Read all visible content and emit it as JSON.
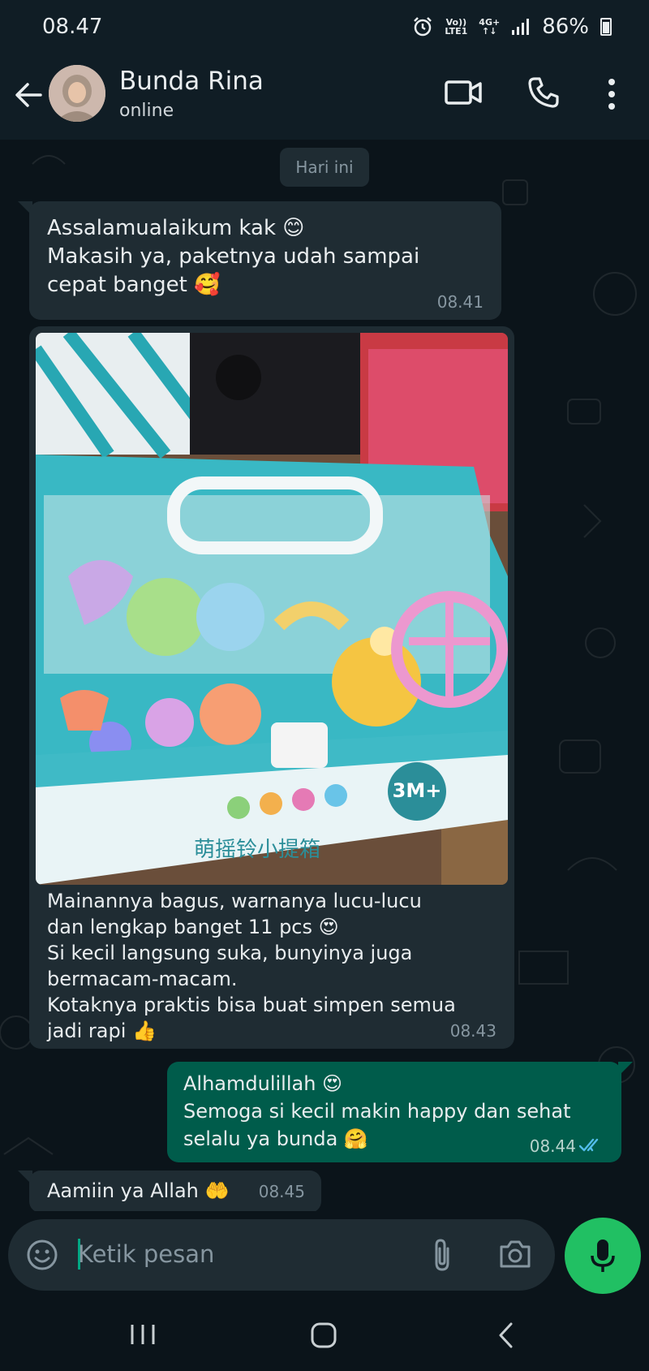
{
  "status_bar": {
    "time": "08.47",
    "network_volte": "Vo))",
    "network_lte": "LTE1",
    "network_4g": "4G+",
    "battery": "86%"
  },
  "header": {
    "contact_name": "Bunda Rina",
    "contact_status": "online"
  },
  "chat": {
    "date_chip": "Hari ini",
    "messages": [
      {
        "direction": "in",
        "lines": [
          "Assalamualaikum kak 😊",
          "Makasih ya, paketnya udah sampai",
          "cepat banget 🥰"
        ],
        "time": "08.41"
      },
      {
        "direction": "in",
        "has_image": true,
        "image_text": {
          "age_badge": "3M+",
          "box_label": "萌摇铃小提箱"
        },
        "lines": [
          "Mainannya bagus, warnanya lucu-lucu",
          "dan lengkap banget 11 pcs 😍",
          "Si kecil langsung suka, bunyinya juga",
          "bermacam-macam.",
          "Kotaknya praktis bisa buat simpen semua",
          "jadi rapi 👍"
        ],
        "time": "08.43"
      },
      {
        "direction": "out",
        "lines": [
          "Alhamdulillah 😍",
          "Semoga si kecil makin happy dan sehat",
          "selalu ya bunda 🤗"
        ],
        "time": "08.44",
        "read_receipt": "double-check-blue"
      },
      {
        "direction": "in",
        "lines": [
          "Aamiin ya Allah 🤲"
        ],
        "time": "08.45"
      }
    ]
  },
  "composer": {
    "placeholder": "Ketik pesan"
  },
  "colors": {
    "background": "#0b141a",
    "bubble_in": "#1f2c33",
    "bubble_out": "#005c4b",
    "accent_green": "#21c063",
    "read_tick": "#53bdeb"
  }
}
